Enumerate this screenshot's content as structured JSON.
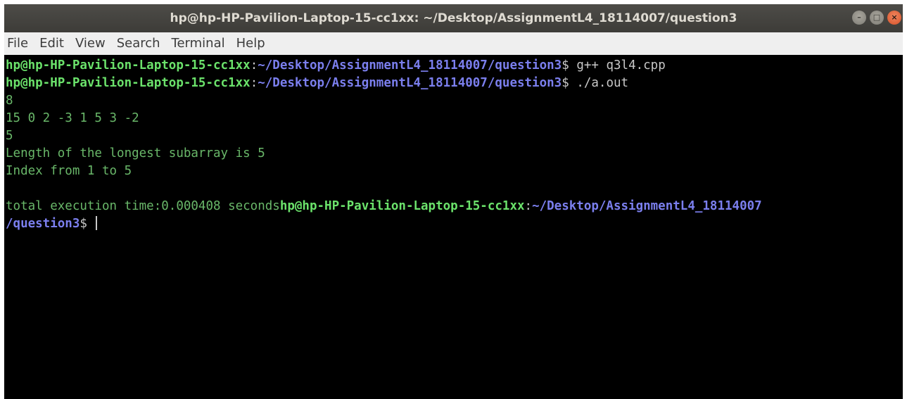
{
  "window": {
    "title": "hp@hp-HP-Pavilion-Laptop-15-cc1xx: ~/Desktop/AssignmentL4_18114007/question3",
    "controls": {
      "minimize": "–",
      "maximize": "□",
      "close": "×"
    }
  },
  "menubar": {
    "items": [
      "File",
      "Edit",
      "View",
      "Search",
      "Terminal",
      "Help"
    ]
  },
  "terminal": {
    "user_host": "hp@hp-HP-Pavilion-Laptop-15-cc1xx",
    "path": "~/Desktop/AssignmentL4_18114007/question3",
    "path_line_a": "~/Desktop/AssignmentL4_18114007",
    "path_line_b": "/question3",
    "colon": ":",
    "prompt_symbol": "$",
    "commands": [
      "g++ q3l4.cpp",
      "./a.out"
    ],
    "outputs": [
      "8",
      "15 0 2 -3 1 5 3 -2",
      "5",
      "Length of the longest subarray is 5",
      "Index from 1 to 5",
      ""
    ],
    "exec_time": "total execution time:0.000408 seconds"
  },
  "colors": {
    "user": "#6be26b",
    "path": "#7b7fee",
    "output": "#69b769",
    "background": "#000000"
  }
}
